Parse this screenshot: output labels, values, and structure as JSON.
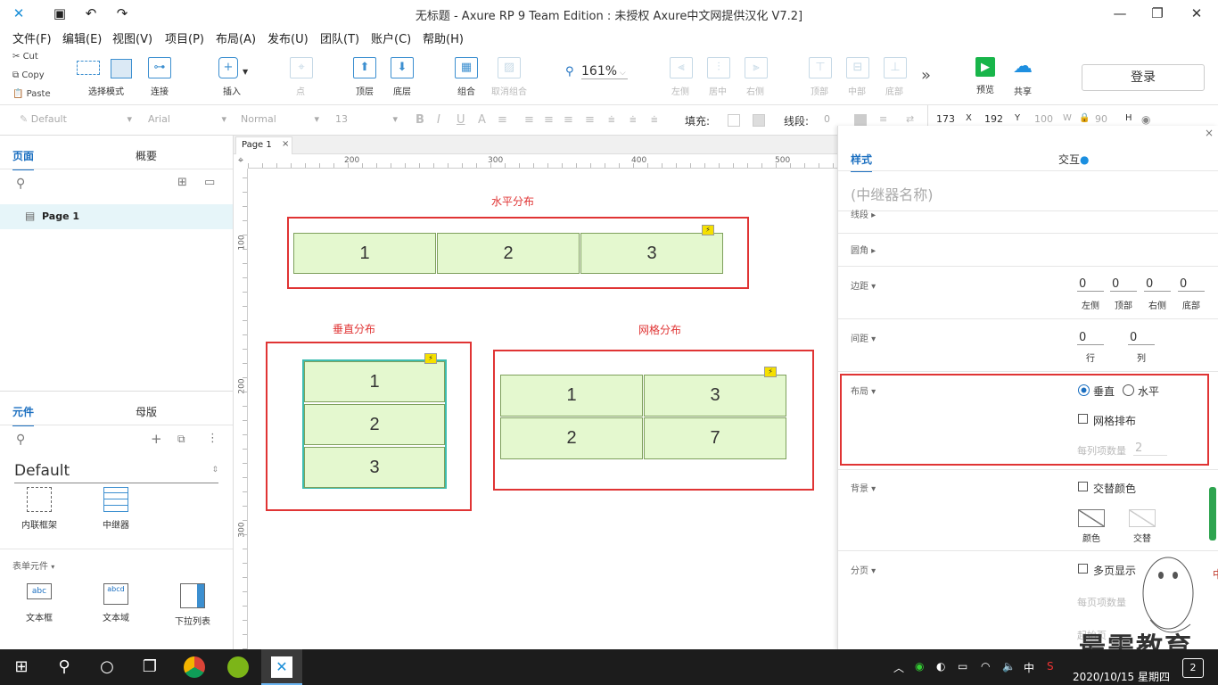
{
  "window": {
    "title": "无标题 - Axure RP 9 Team Edition : 未授权     Axure中文网提供汉化 V7.2]"
  },
  "menu": [
    "文件(F)",
    "编辑(E)",
    "视图(V)",
    "项目(P)",
    "布局(A)",
    "发布(U)",
    "团队(T)",
    "账户(C)",
    "帮助(H)"
  ],
  "clipboard": {
    "cut": "Cut",
    "copy": "Copy",
    "paste": "Paste"
  },
  "toolbar": {
    "select_mode": "选择模式",
    "connect": "连接",
    "insert": "插入",
    "point": "点",
    "top_layer": "顶层",
    "bottom_layer": "底层",
    "group": "组合",
    "ungroup": "取消组合",
    "zoom": "161%",
    "align_left": "左侧",
    "align_center": "居中",
    "align_right": "右侧",
    "align_top": "顶部",
    "align_middle": "中部",
    "align_bottom": "底部",
    "preview": "预览",
    "share": "共享",
    "login": "登录"
  },
  "formatbar": {
    "style": "Default",
    "font": "Arial",
    "weight": "Normal",
    "size": "13",
    "fill_label": "填充:",
    "stroke_label": "线段:",
    "stroke_value": "0",
    "x": "173",
    "x_label": "X",
    "y": "192",
    "y_label": "Y",
    "w": "100",
    "w_label": "W",
    "h": "90",
    "h_label": "H"
  },
  "pages_panel": {
    "tab_pages": "页面",
    "tab_outline": "概要",
    "page_item": "Page 1"
  },
  "library_panel": {
    "tab_widgets": "元件",
    "tab_masters": "母版",
    "library_name": "Default",
    "items_top": [
      "内联框架",
      "中继器"
    ],
    "form_section": "表单元件",
    "items_form": [
      "文本框",
      "文本域",
      "下拉列表"
    ]
  },
  "canvas": {
    "page_tab": "Page 1",
    "ruler_h": [
      "200",
      "300",
      "400",
      "500"
    ],
    "ruler_v": [
      "100",
      "200",
      "300"
    ],
    "horizontal": {
      "label": "水平分布",
      "cells": [
        "1",
        "2",
        "3"
      ]
    },
    "vertical": {
      "label": "垂直分布",
      "cells": [
        "1",
        "2",
        "3"
      ]
    },
    "grid": {
      "label": "网格分布",
      "cells": [
        "1",
        "3",
        "2",
        "7"
      ]
    }
  },
  "inspector": {
    "tab_style": "样式",
    "tab_interaction": "交互",
    "name_placeholder": "(中继器名称)",
    "stroke": "线段",
    "corner": "圆角",
    "padding": "边距",
    "padding_values": {
      "left": "0",
      "top": "0",
      "right": "0",
      "bottom": "0"
    },
    "padding_labels": {
      "left": "左侧",
      "top": "顶部",
      "right": "右侧",
      "bottom": "底部"
    },
    "spacing": "间距",
    "spacing_values": {
      "row": "0",
      "col": "0"
    },
    "spacing_labels": {
      "row": "行",
      "col": "列"
    },
    "layout": "布局",
    "layout_vertical": "垂直",
    "layout_horizontal": "水平",
    "grid_arrange": "网格排布",
    "items_per_col": "每列项数量",
    "items_per_col_value": "2",
    "background": "背景",
    "alternate_color": "交替颜色",
    "color_label": "颜色",
    "alt_label": "交替",
    "pagination": "分页",
    "multi_page": "多页显示",
    "items_per_page": "每页项数量",
    "start_page": "起始页"
  },
  "taskbar": {
    "ime": "中",
    "date": "2020/10/15 星期四",
    "notif": "2",
    "watermark": "最需教育"
  }
}
